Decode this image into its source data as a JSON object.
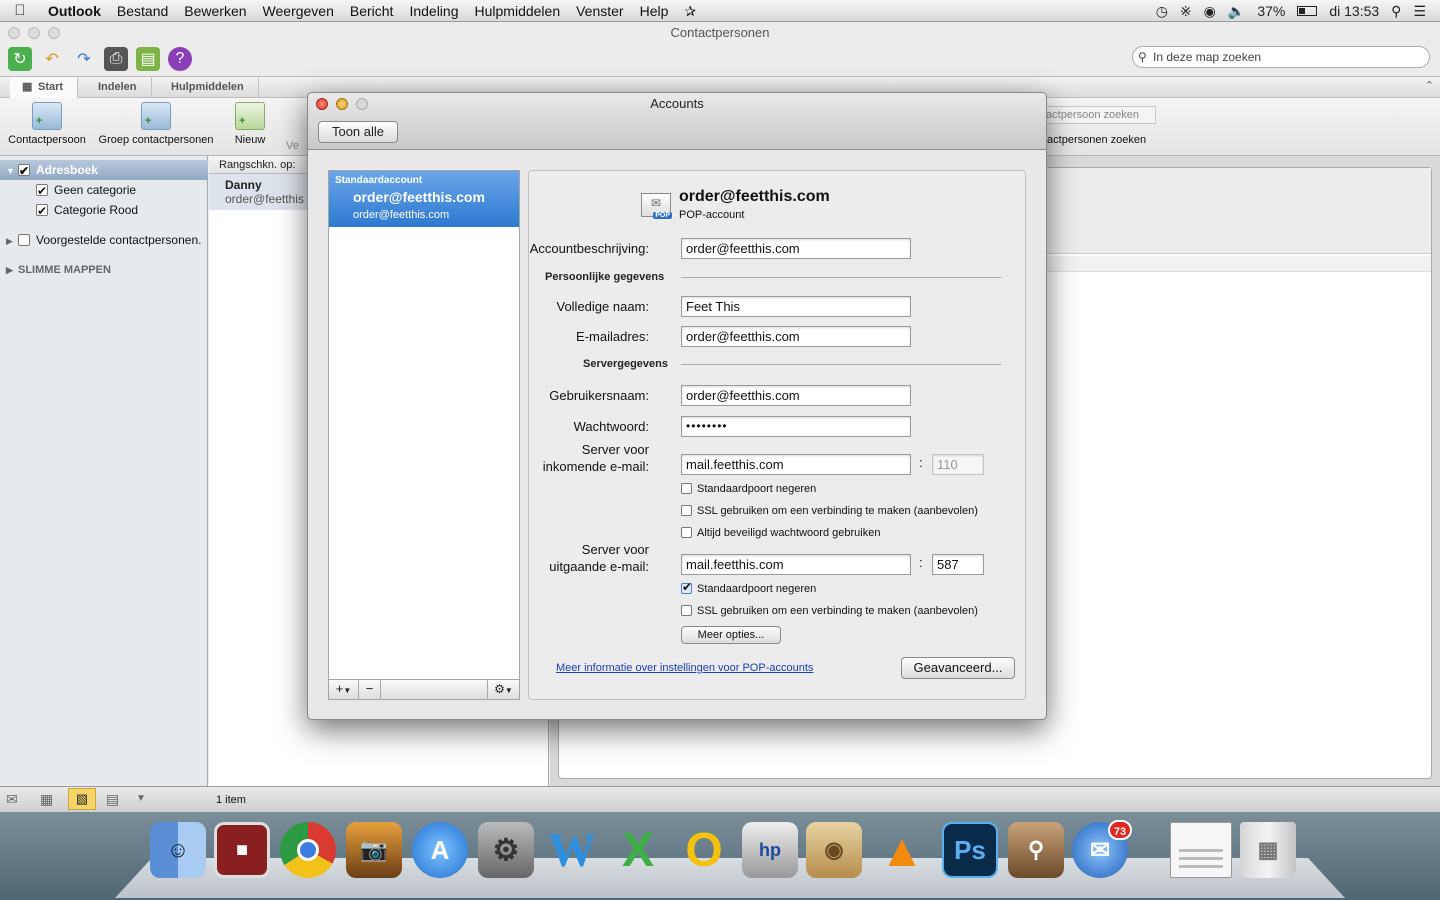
{
  "menubar": {
    "app": "Outlook",
    "items": [
      "Bestand",
      "Bewerken",
      "Weergeven",
      "Bericht",
      "Indeling",
      "Hulpmiddelen",
      "Venster",
      "Help"
    ],
    "battery": "37%",
    "clock": "di 13:53"
  },
  "window": {
    "title": "Contactpersonen",
    "search_placeholder": "In deze map zoeken"
  },
  "ribbon": {
    "tabs": [
      "Start",
      "Indelen",
      "Hulpmiddelen"
    ],
    "buttons": {
      "contact": "Contactpersoon",
      "group": "Groep contactpersonen",
      "new": "Nieuw",
      "partial": "Ve"
    },
    "search_contacts_field": "tactpersoon zoeken",
    "search_contacts_label": "tactpersonen zoeken"
  },
  "sidebar": {
    "addressbook": "Adresboek",
    "categories": [
      "Geen categorie",
      "Categorie Rood"
    ],
    "suggested": "Voorgestelde contactpersonen.",
    "smart_folders": "SLIMME MAPPEN"
  },
  "list": {
    "sort_label": "Rangschkn. op:",
    "contact_name": "Danny",
    "contact_email": "order@feetthis"
  },
  "status": {
    "count": "1 item"
  },
  "dialog": {
    "title": "Accounts",
    "show_all": "Toon alle",
    "account_list": {
      "header": "Standaardaccount",
      "name": "order@feetthis.com",
      "email": "order@feetthis.com"
    },
    "account": {
      "name": "order@feetthis.com",
      "type": "POP-account",
      "badge": "POP"
    },
    "fields": {
      "description_label": "Accountbeschrijving:",
      "description_value": "order@feetthis.com",
      "personal_section": "Persoonlijke gegevens",
      "fullname_label": "Volledige naam:",
      "fullname_value": "Feet This",
      "email_label": "E-mailadres:",
      "email_value": "order@feetthis.com",
      "server_section": "Servergegevens",
      "username_label": "Gebruikersnaam:",
      "username_value": "order@feetthis.com",
      "password_label": "Wachtwoord:",
      "password_value": "••••••••",
      "incoming_label_1": "Server voor",
      "incoming_label_2": "inkomende e-mail:",
      "incoming_value": "mail.feetthis.com",
      "incoming_port": "110",
      "outgoing_label_1": "Server voor",
      "outgoing_label_2": "uitgaande e-mail:",
      "outgoing_value": "mail.feetthis.com",
      "outgoing_port": "587",
      "port_sep": ":"
    },
    "options": {
      "in_override_port": "Standaardpoort negeren",
      "in_ssl": "SSL gebruiken om een verbinding te maken (aanbevolen)",
      "in_secure_pw": "Altijd beveiligd wachtwoord gebruiken",
      "out_override_port": "Standaardpoort negeren",
      "out_ssl": "SSL gebruiken om een verbinding te maken (aanbevolen)"
    },
    "more_options": "Meer opties...",
    "help_link": "Meer informatie over instellingen voor POP-accounts",
    "advanced": "Geavanceerd...",
    "add_btn": "+",
    "remove_btn": "−"
  },
  "dock": {
    "badge": "73",
    "word": "W",
    "excel": "X",
    "outlook": "O",
    "photoshop": "Ps"
  }
}
